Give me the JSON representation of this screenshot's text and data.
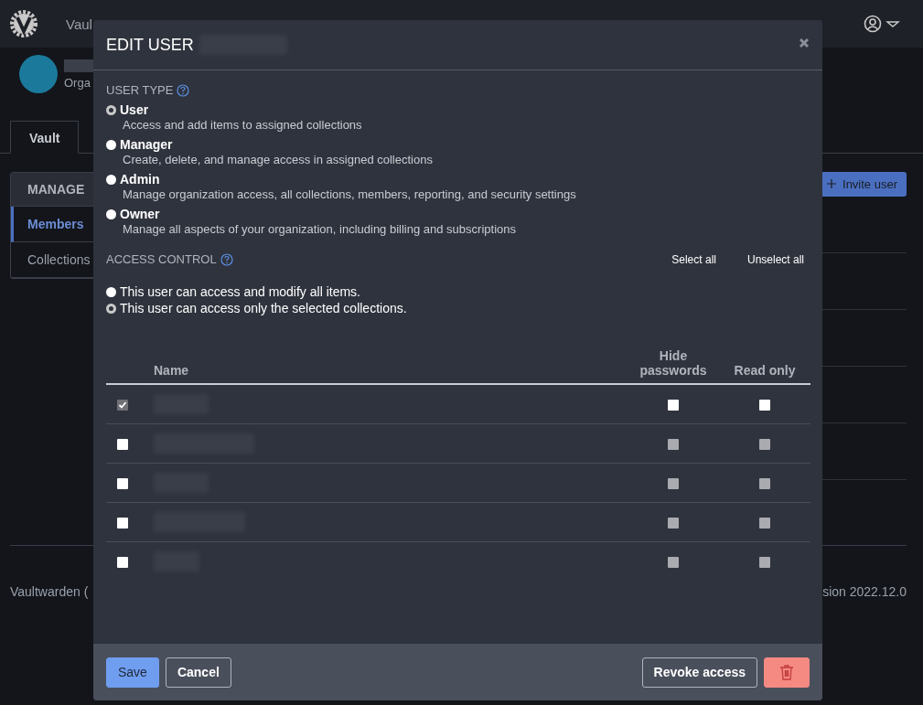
{
  "navbar": {
    "items": [
      {
        "label": "Vaul"
      }
    ]
  },
  "org": {
    "subtitle": "Orga"
  },
  "tabs": [
    {
      "label": "Vault",
      "selected": true
    }
  ],
  "sidebar": {
    "heading": "MANAGE",
    "items": [
      {
        "label": "Members",
        "selected": true
      },
      {
        "label": "Collections",
        "selected": false
      }
    ]
  },
  "invite_button": "Invite user",
  "footer": {
    "left": "Vaultwarden (",
    "right": "sion 2022.12.0"
  },
  "dialog": {
    "title": "EDIT USER",
    "user_type": {
      "heading": "USER TYPE",
      "options": [
        {
          "label": "User",
          "description": "Access and add items to assigned collections",
          "selected": true
        },
        {
          "label": "Manager",
          "description": "Create, delete, and manage access in assigned collections",
          "selected": false
        },
        {
          "label": "Admin",
          "description": "Manage organization access, all collections, members, reporting, and security settings",
          "selected": false
        },
        {
          "label": "Owner",
          "description": "Manage all aspects of your organization, including billing and subscriptions",
          "selected": false
        }
      ]
    },
    "access_control": {
      "heading": "ACCESS CONTROL",
      "links": [
        "Select all",
        "Unselect all"
      ],
      "options": [
        {
          "label": "This user can access and modify all items.",
          "selected": false
        },
        {
          "label": "This user can access only the selected collections.",
          "selected": true
        }
      ]
    },
    "table": {
      "columns": [
        "Name",
        "Hide passwords",
        "Read only"
      ],
      "rows": [
        {
          "checked": true,
          "hide_passwords": {
            "checked": false,
            "disabled": false
          },
          "read_only": {
            "checked": false,
            "disabled": false
          }
        },
        {
          "checked": false,
          "hide_passwords": {
            "checked": false,
            "disabled": true
          },
          "read_only": {
            "checked": false,
            "disabled": true
          }
        },
        {
          "checked": false,
          "hide_passwords": {
            "checked": false,
            "disabled": true
          },
          "read_only": {
            "checked": false,
            "disabled": true
          }
        },
        {
          "checked": false,
          "hide_passwords": {
            "checked": false,
            "disabled": true
          },
          "read_only": {
            "checked": false,
            "disabled": true
          }
        },
        {
          "checked": false,
          "hide_passwords": {
            "checked": false,
            "disabled": true
          },
          "read_only": {
            "checked": false,
            "disabled": true
          }
        }
      ]
    },
    "buttons": {
      "save": "Save",
      "cancel": "Cancel",
      "revoke": "Revoke access"
    }
  }
}
